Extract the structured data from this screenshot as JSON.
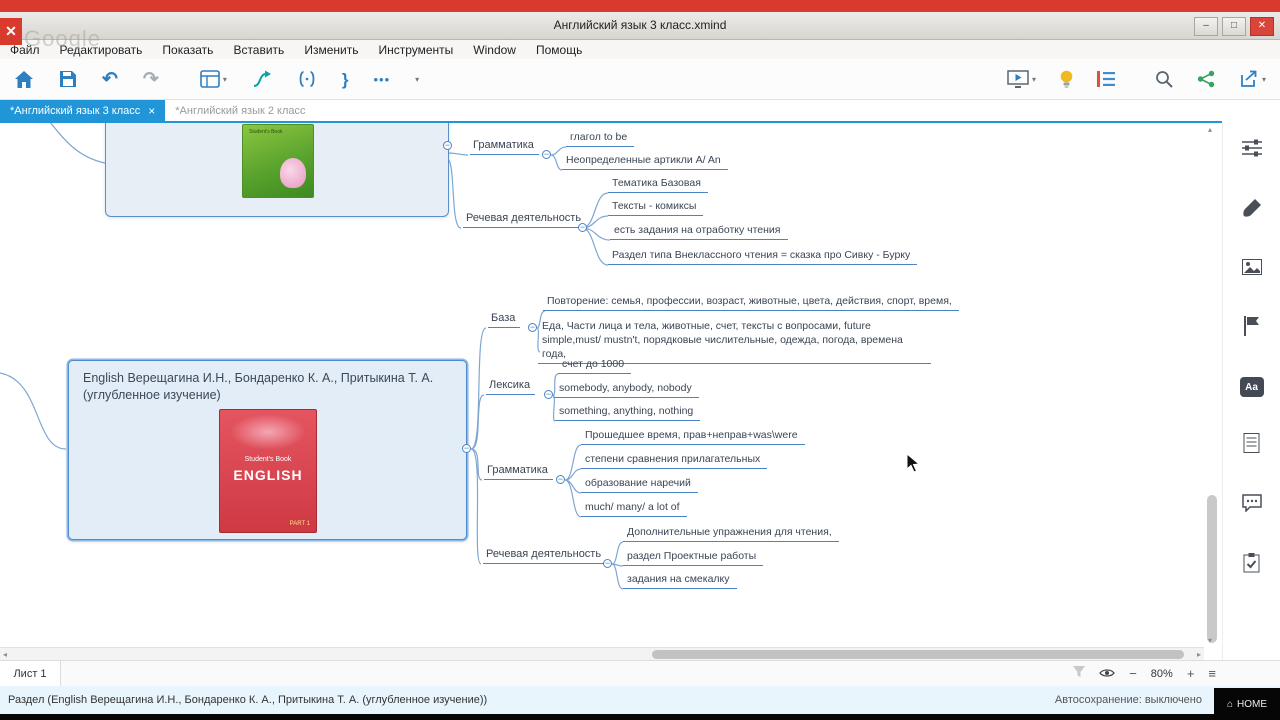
{
  "window": {
    "title": "Английский язык 3 класс.xmind",
    "logo": "✕",
    "watermark": "Google",
    "controls": {
      "minimize": "–",
      "maximize": "□",
      "close": "✕"
    }
  },
  "menu": {
    "items": [
      "Файл",
      "Редактировать",
      "Показать",
      "Вставить",
      "Изменить",
      "Инструменты",
      "Window",
      "Помощь"
    ]
  },
  "icons": {
    "minus": "−",
    "caret": "▾",
    "ellipsis": "•••",
    "undo": "↶",
    "redo": "↷",
    "summary": "}",
    "tab_close": "×",
    "scroll_left": "◂",
    "scroll_right": "▸",
    "scroll_up": "▴",
    "scroll_down": "▾",
    "zoom_out": "−",
    "zoom_in": "+",
    "sheet_menu": "≡",
    "home": "⌂",
    "aa": "Aa"
  },
  "tabs": [
    {
      "label": "*Английский язык 3 класс"
    },
    {
      "label": "*Английский язык 2 класс"
    }
  ],
  "map": {
    "secondary": {
      "book_label": "Student's Book"
    },
    "top_groups": [
      {
        "label": "Грамматика",
        "children": [
          "глагол to be",
          "Неопределенные артикли A/ An"
        ]
      },
      {
        "label": "Речевая деятельность",
        "children": [
          "Тематика Базовая",
          "Тексты - комиксы",
          "есть задания на отработку чтения",
          "Раздел типа Внеклассного чтения = сказка про Сивку - Бурку"
        ]
      }
    ],
    "main": {
      "title": "English Верещагина И.Н., Бондаренко К. А., Притыкина Т. А. (углубленное изучение)",
      "book": {
        "series": "Student's Book",
        "title": "ENGLISH",
        "part": "PART 1"
      }
    },
    "groups": [
      {
        "label": "База",
        "children": [
          "Повторение: семья, профессии, возраст, животные, цвета, действия, спорт, время,",
          "Еда, Части лица и тела, животные, счет, тексты с вопросами, future simple,must/ mustn't, порядковые числительные, одежда, погода, времена года,"
        ]
      },
      {
        "label": "Лексика",
        "children": [
          "счет до 1000",
          "somebody, anybody, nobody",
          "something, anything, nothing"
        ]
      },
      {
        "label": "Грамматика",
        "children": [
          "Прошедшее время, прав+неправ+was\\were",
          "степени сравнения прилагательных",
          "образование наречий",
          "much/ many/ a lot of"
        ]
      },
      {
        "label": "Речевая деятельность",
        "children": [
          "Дополнительные упражнения для чтения,",
          "раздел Проектные работы",
          "задания на смекалку"
        ]
      }
    ]
  },
  "sheet_bar": {
    "sheet": "Лист 1",
    "zoom": "80%"
  },
  "status_bar": {
    "selection": "Раздел (English Верещагина И.Н., Бондаренко К. А., Притыкина Т. А. (углубленное изучение))",
    "autosave": "Автосохранение: выключено",
    "home": "HOME"
  }
}
